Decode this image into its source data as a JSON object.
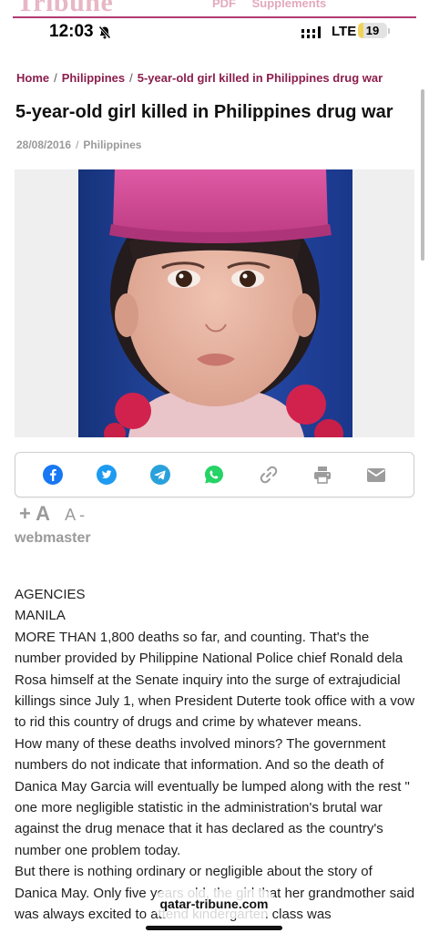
{
  "site": {
    "logo": "Tribune",
    "nav": [
      "PDF",
      "Supplements"
    ],
    "accent": "#8b1f4e"
  },
  "status_bar": {
    "time": "12:03",
    "network": "LTE",
    "battery": "19",
    "battery_level": 0.19
  },
  "breadcrumb": [
    "Home",
    "Philippines",
    "5-year-old girl killed in Philippines drug war"
  ],
  "article": {
    "title": "5-year-old girl killed in Philippines drug war",
    "date": "28/08/2016",
    "category": "Philippines",
    "author": "webmaster",
    "body": [
      "AGENCIES",
      "MANILA",
      "MORE THAN 1,800 deaths so far, and counting. That's the number provided by Philippine National Police chief Ronald dela Rosa himself at the Senate inquiry into the surge of extrajudicial killings since July 1, when President Duterte took office with a vow to rid this country of drugs and crime by whatever means.",
      "How many of these deaths involved minors? The government numbers do not indicate that information. And so the death of Danica May Garcia will eventually be lumped along with the rest \" one more negligible statistic in the administration's brutal war against the drug menace that it has declared as the country's number one problem today.",
      "But there is nothing ordinary or negligible about the story of Danica May. Only five years old, the girl that her grandmother said was always excited to attend kindergarten class was"
    ]
  },
  "share": {
    "icons": [
      "facebook-icon",
      "twitter-icon",
      "telegram-icon",
      "whatsapp-icon",
      "link-icon",
      "print-icon",
      "email-icon"
    ],
    "colors": {
      "facebook": "#1877f2",
      "twitter": "#1d9bf0",
      "telegram": "#2aa1da",
      "whatsapp": "#25d366",
      "neutral": "#9c9c9c"
    }
  },
  "font_controls": {
    "increase": "+ A",
    "decrease": "A -"
  },
  "url_bar": {
    "url": "qatar-tribune.com"
  }
}
